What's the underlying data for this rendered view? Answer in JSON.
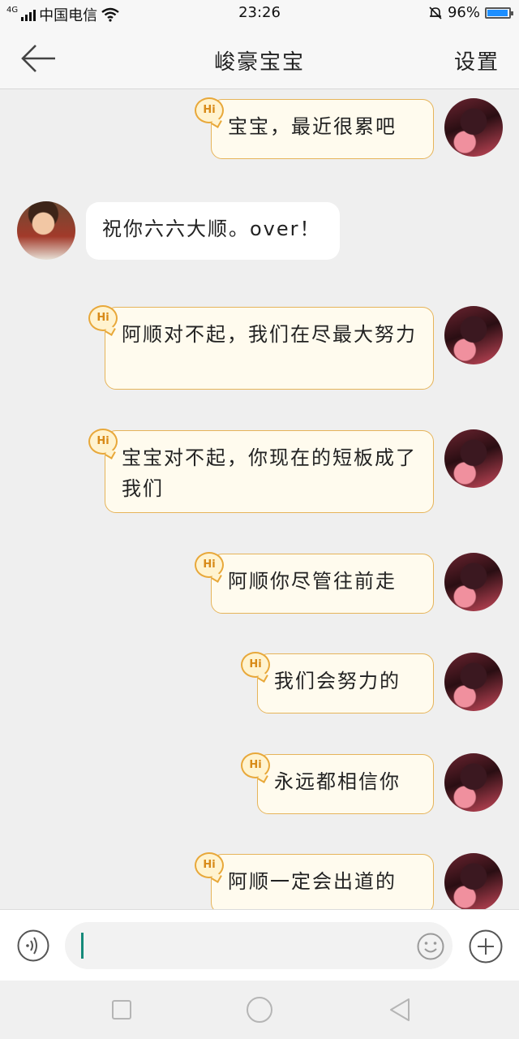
{
  "status_bar": {
    "network": "4G",
    "carrier": "中国电信",
    "time": "23:26",
    "battery_percent": "96%",
    "battery_level": 0.96
  },
  "header": {
    "title": "峻豪宝宝",
    "settings_label": "设置"
  },
  "messages": [
    {
      "sender": "me",
      "text": "宝宝，最近很累吧",
      "badge": "Hi"
    },
    {
      "sender": "other",
      "text": "祝你六六大顺。over！"
    },
    {
      "sender": "me",
      "text": "阿顺对不起，我们在尽最大努力",
      "badge": "Hi"
    },
    {
      "sender": "me",
      "text": "宝宝对不起，你现在的短板成了我们",
      "badge": "Hi"
    },
    {
      "sender": "me",
      "text": "阿顺你尽管往前走",
      "badge": "Hi"
    },
    {
      "sender": "me",
      "text": "我们会努力的",
      "badge": "Hi"
    },
    {
      "sender": "me",
      "text": "永远都相信你",
      "badge": "Hi"
    },
    {
      "sender": "me",
      "text": "阿顺一定会出道的",
      "badge": "Hi"
    }
  ],
  "input": {
    "value": "",
    "placeholder": ""
  },
  "icons": {
    "back": "arrow-left-icon",
    "voice": "voice-icon",
    "emoji": "emoji-icon",
    "plus": "plus-icon",
    "nav_recent": "square-icon",
    "nav_home": "circle-icon",
    "nav_back": "triangle-back-icon"
  },
  "colors": {
    "bubble_me_bg": "#fffbee",
    "bubble_me_border": "#e6b45a",
    "bubble_other_bg": "#ffffff",
    "chat_bg": "#efefef",
    "caret": "#158a7a",
    "battery": "#1e8fff"
  }
}
